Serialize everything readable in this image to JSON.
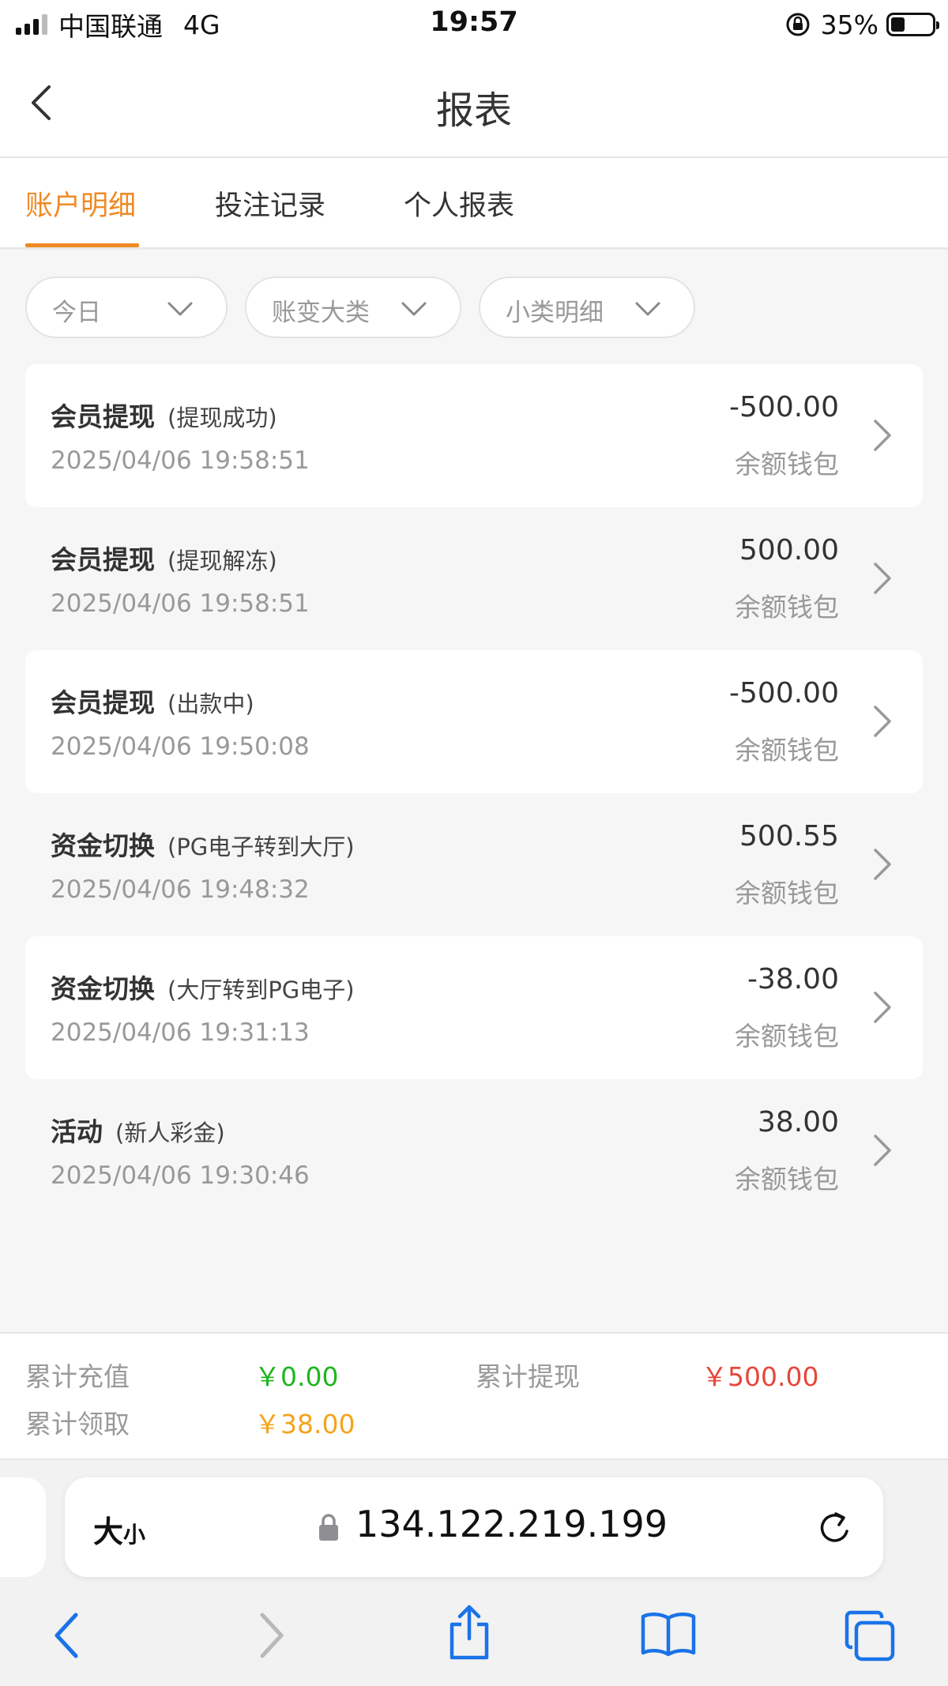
{
  "status_bar": {
    "carrier": "中国联通",
    "network": "4G",
    "time": "19:57",
    "battery": "35%"
  },
  "nav": {
    "title": "报表"
  },
  "tabs": [
    {
      "label": "账户明细",
      "active": true
    },
    {
      "label": "投注记录",
      "active": false
    },
    {
      "label": "个人报表",
      "active": false
    }
  ],
  "filters": [
    {
      "label": "今日"
    },
    {
      "label": "账变大类"
    },
    {
      "label": "小类明细"
    }
  ],
  "records": [
    {
      "type": "会员提现",
      "sub": "(提现成功)",
      "date": "2025/04/06 19:58:51",
      "amount": "-500.00",
      "wallet": "余额钱包"
    },
    {
      "type": "会员提现",
      "sub": "(提现解冻)",
      "date": "2025/04/06 19:58:51",
      "amount": "500.00",
      "wallet": "余额钱包"
    },
    {
      "type": "会员提现",
      "sub": "(出款中)",
      "date": "2025/04/06 19:50:08",
      "amount": "-500.00",
      "wallet": "余额钱包"
    },
    {
      "type": "资金切换",
      "sub": "(PG电子转到大厅)",
      "date": "2025/04/06 19:48:32",
      "amount": "500.55",
      "wallet": "余额钱包"
    },
    {
      "type": "资金切换",
      "sub": "(大厅转到PG电子)",
      "date": "2025/04/06 19:31:13",
      "amount": "-38.00",
      "wallet": "余额钱包"
    },
    {
      "type": "活动",
      "sub": "(新人彩金)",
      "date": "2025/04/06 19:30:46",
      "amount": "38.00",
      "wallet": "余额钱包"
    }
  ],
  "summary": {
    "recharge_label": "累计充值",
    "recharge_value": "￥0.00",
    "withdraw_label": "累计提现",
    "withdraw_value": "￥500.00",
    "claim_label": "累计领取",
    "claim_value": "￥38.00"
  },
  "browser": {
    "text_size_big": "大",
    "text_size_small": "小",
    "url": "134.122.219.199"
  },
  "colors": {
    "accent": "#f08a24",
    "recharge": "#1fb51f",
    "withdraw": "#e5473b",
    "claim": "#f3a41c",
    "safari_blue": "#1a73e8"
  },
  "icons": {
    "back": "chevron-left-icon",
    "filter_chevron": "chevron-down-icon",
    "row_chevron": "chevron-right-icon",
    "lock": "lock-icon",
    "reload": "reload-icon",
    "share": "share-icon",
    "bookmarks": "book-icon",
    "tabs": "tabs-icon"
  }
}
